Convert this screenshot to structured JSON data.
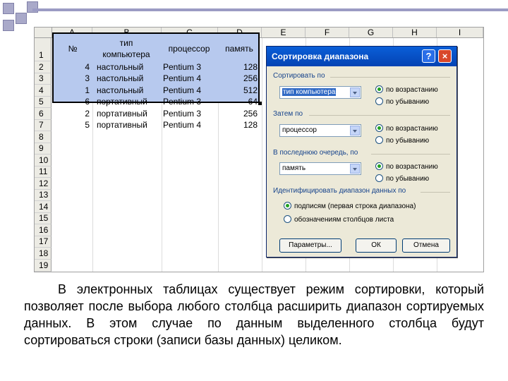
{
  "columns": [
    "A",
    "B",
    "C",
    "D",
    "E",
    "F",
    "G",
    "H",
    "I"
  ],
  "rows": [
    "1",
    "2",
    "3",
    "4",
    "5",
    "6",
    "7",
    "8",
    "9",
    "10",
    "11",
    "12",
    "13",
    "14",
    "15",
    "16",
    "17",
    "18",
    "19"
  ],
  "header_row": {
    "a": "№",
    "b_line1": "тип",
    "b_line2": "компьютера",
    "c": "процессор",
    "d": "память"
  },
  "data_rows": [
    {
      "a": "4",
      "b": "настольный",
      "c": "Pentium 3",
      "d": "128"
    },
    {
      "a": "3",
      "b": "настольный",
      "c": "Pentium 4",
      "d": "256"
    },
    {
      "a": "1",
      "b": "настольный",
      "c": "Pentium 4",
      "d": "512"
    },
    {
      "a": "6",
      "b": "портативный",
      "c": "Pentium 3",
      "d": "64"
    },
    {
      "a": "2",
      "b": "портативный",
      "c": "Pentium 3",
      "d": "256"
    },
    {
      "a": "5",
      "b": "портативный",
      "c": "Pentium 4",
      "d": "128"
    }
  ],
  "dialog": {
    "title": "Сортировка диапазона",
    "help_symbol": "?",
    "close_symbol": "×",
    "sort_by_label": "Сортировать по",
    "sort_by_value": "тип компьютера",
    "then_by_label": "Затем по",
    "then_by_value": "процессор",
    "last_by_label": "В последнюю очередь, по",
    "last_by_value": "память",
    "ascending": "по возрастанию",
    "descending": "по убыванию",
    "identify_label": "Идентифицировать диапазон данных по",
    "identify_labels": "подписям (первая строка диапазона)",
    "identify_designations": "обозначениям столбцов листа",
    "params_button": "Параметры...",
    "ok_button": "ОК",
    "cancel_button": "Отмена"
  },
  "body_text": "В электронных таблицах существует режим сортировки, который позволяет после выбора любого столбца расширить диапазон сортируемых данных. В этом случае по данным выделенного столбца будут сортироваться строки (записи базы данных) целиком.",
  "colors": {
    "selection": "#b7c9ee",
    "titlebar": "#0a5fd8",
    "dialog_bg": "#ece9d8",
    "deco": "#9b9bc4"
  }
}
